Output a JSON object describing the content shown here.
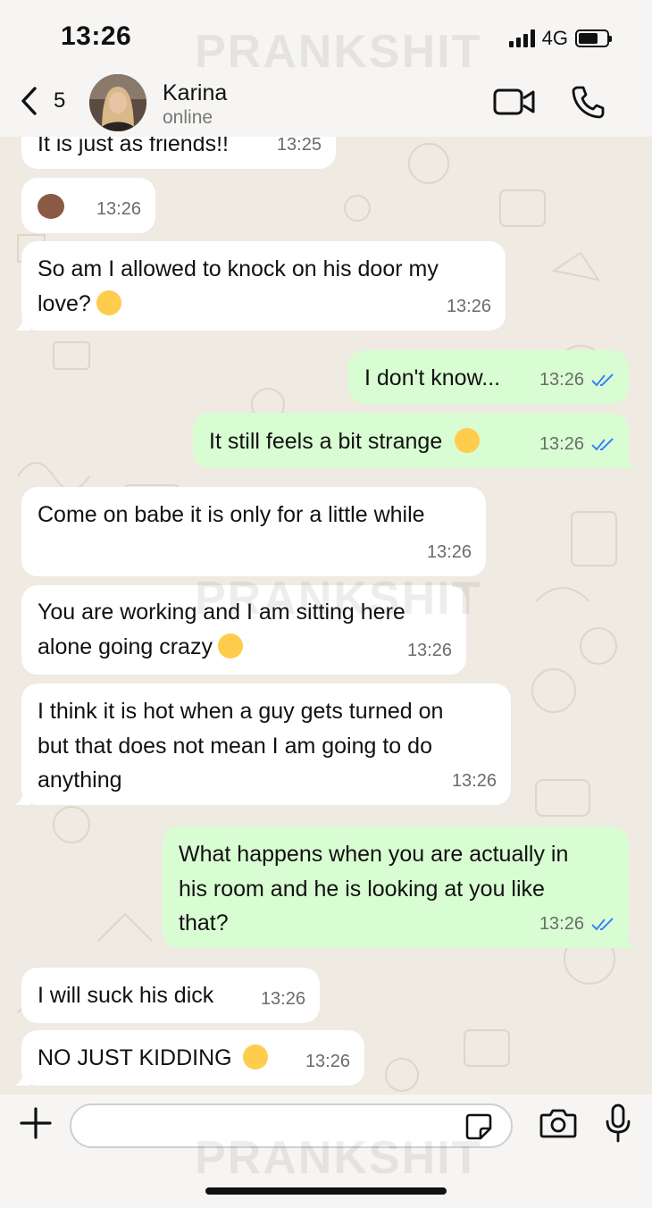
{
  "status_bar": {
    "time": "13:26",
    "network": "4G",
    "battery_level": 0.7
  },
  "watermark": "PRANKSHIT",
  "header": {
    "back_count": "5",
    "contact_name": "Karina",
    "contact_status": "online",
    "icons": {
      "back": "chevron-left-icon",
      "video": "video-camera-icon",
      "call": "phone-icon"
    }
  },
  "messages": [
    {
      "direction": "in",
      "text": "It is just as friends!!",
      "time": "13:25"
    },
    {
      "direction": "in",
      "text": "",
      "emoji": "see-no-evil-monkey",
      "time": "13:26"
    },
    {
      "direction": "in",
      "text": "So am I allowed to knock on his door my\nlove?",
      "emoji": "smiling-face-with-halo",
      "time": "13:26"
    },
    {
      "direction": "out",
      "text": "I don't know...",
      "time": "13:26",
      "read": true
    },
    {
      "direction": "out",
      "text": "It still feels a bit strange",
      "emoji": "grinning-face-with-sweat",
      "time": "13:26",
      "read": true
    },
    {
      "direction": "in",
      "text": "Come on babe it is only for a little while",
      "time": "13:26"
    },
    {
      "direction": "in",
      "text": "You are working and I am sitting here\nalone going crazy",
      "emoji": "face-holding-back-tears",
      "time": "13:26"
    },
    {
      "direction": "in",
      "text": "I think it is hot when a guy gets turned on\nbut that does not mean I am going to do\nanything",
      "time": "13:26"
    },
    {
      "direction": "out",
      "text": "What happens when you are actually in\nhis room and he is looking at you like\nthat?",
      "time": "13:26",
      "read": true
    },
    {
      "direction": "in",
      "text": "I will suck his dick",
      "time": "13:26"
    },
    {
      "direction": "in",
      "text": "NO JUST KIDDING",
      "emoji": "face-with-hand-over-mouth",
      "time": "13:26"
    }
  ],
  "input_bar": {
    "placeholder": "",
    "icons": {
      "plus": "plus-icon",
      "sticker": "sticker-icon",
      "camera": "camera-icon",
      "mic": "microphone-icon"
    }
  }
}
